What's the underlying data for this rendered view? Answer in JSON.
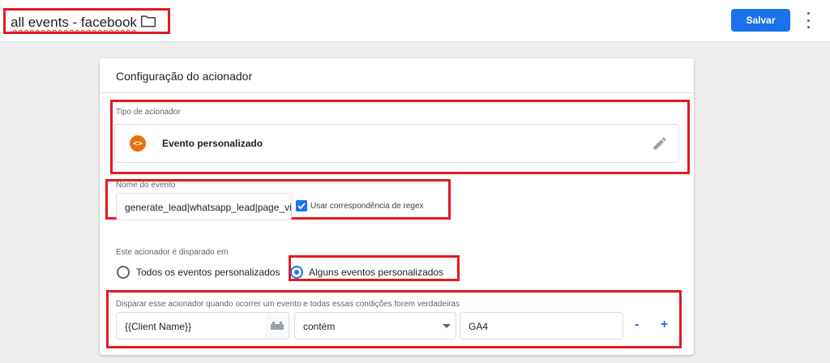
{
  "header": {
    "title": "all events - facebook",
    "folder_icon": "folder-icon",
    "save_label": "Salvar",
    "more_icon": "more-vert-icon"
  },
  "card": {
    "title": "Configuração do acionador",
    "trigger_type": {
      "label": "Tipo de acionador",
      "value": "Evento personalizado",
      "icon": "custom-event-icon",
      "icon_glyph": "<>",
      "edit_icon": "pencil-icon"
    },
    "event_name": {
      "label": "Nome do evento",
      "value": "generate_lead|whatsapp_lead|page_view",
      "regex_checked": true,
      "regex_label": "Usar correspondência de regex"
    },
    "fires_on": {
      "label": "Este acionador é disparado em",
      "options": [
        {
          "label": "Todos os eventos personalizados",
          "selected": false
        },
        {
          "label": "Alguns eventos personalizados",
          "selected": true
        }
      ]
    },
    "condition": {
      "label": "Disparar esse acionador quando ocorrer um evento e todas essas condições forem verdadeiras",
      "variable": "{{Client Name}}",
      "operator": "contém",
      "value": "GA4",
      "remove_label": "-",
      "add_label": "+"
    }
  },
  "colors": {
    "accent": "#1a73e8",
    "annotation_red": "#e01b22",
    "trigger_icon": "#e8710a"
  }
}
